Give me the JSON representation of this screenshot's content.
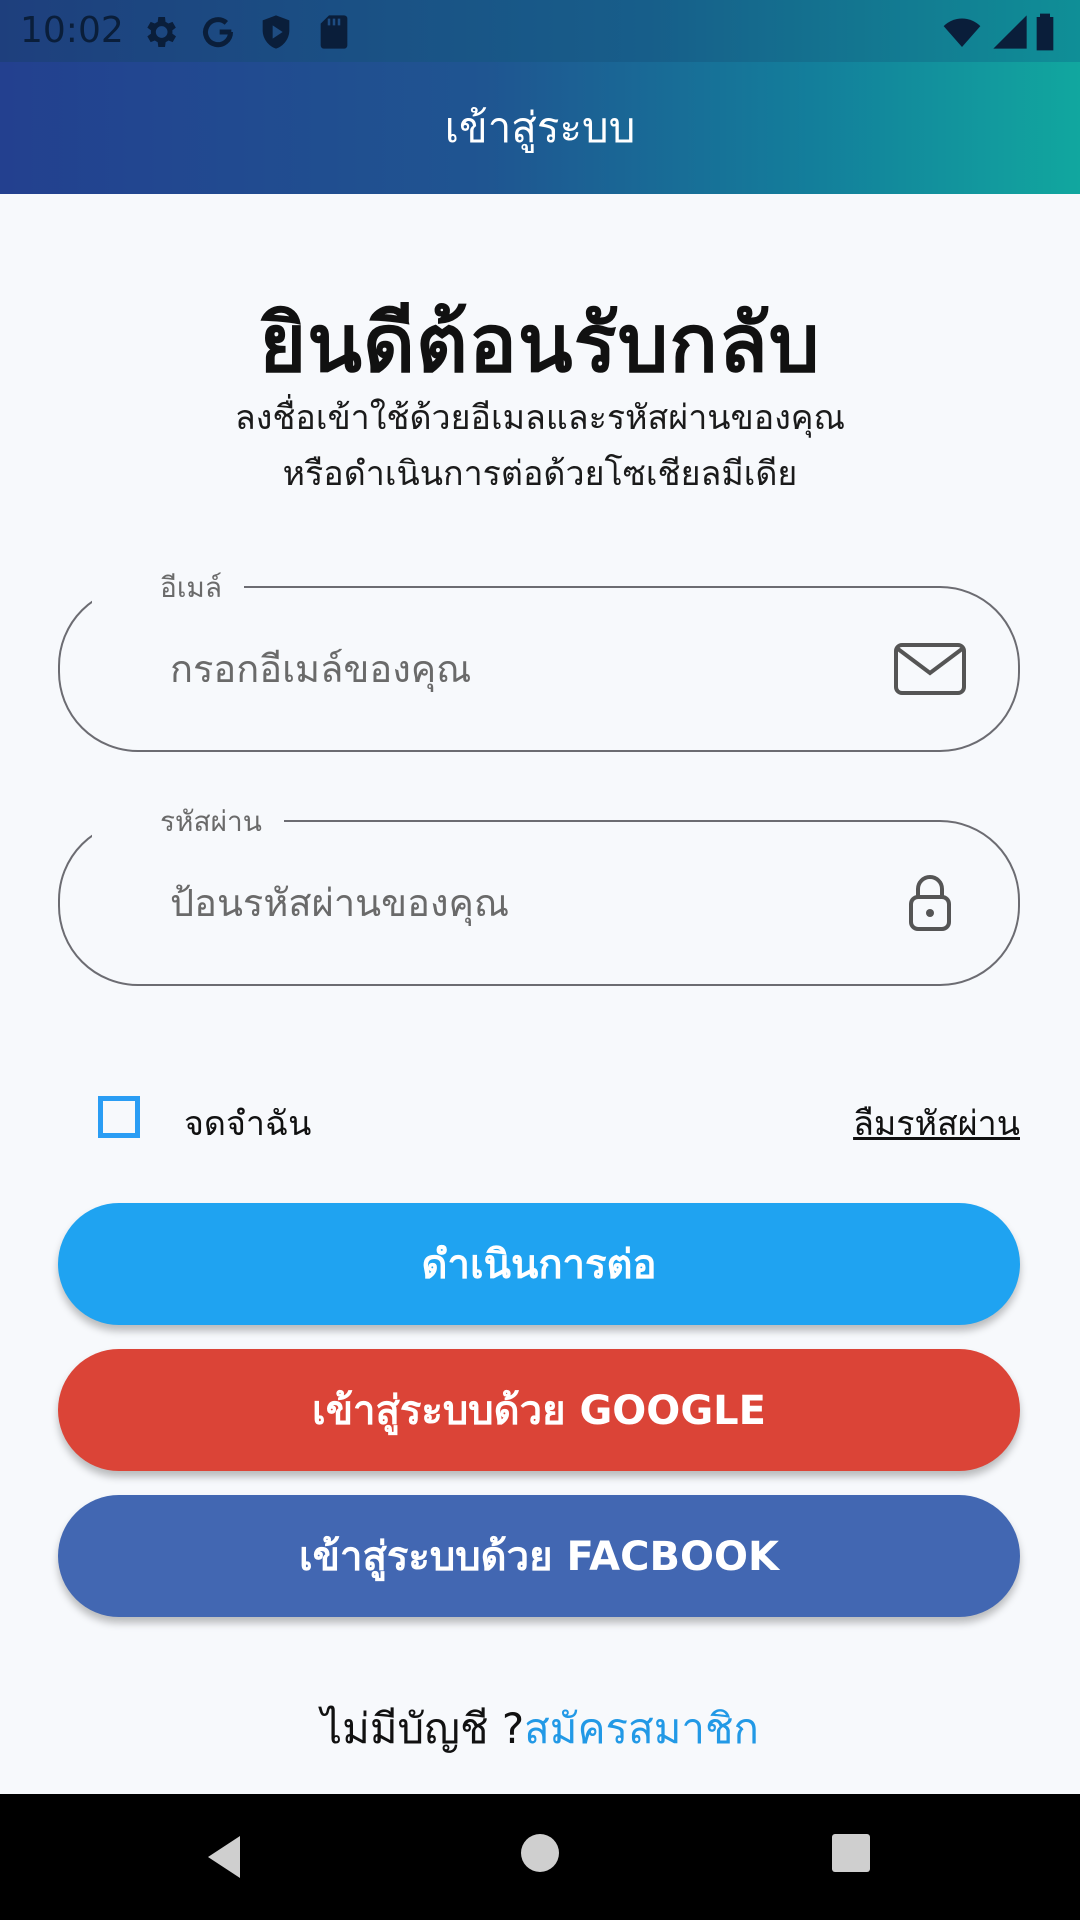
{
  "status_bar": {
    "time": "10:02",
    "icons": [
      "gear-icon",
      "google-icon",
      "shield-icon",
      "sd-card-icon",
      "wifi-icon",
      "signal-icon",
      "battery-icon"
    ]
  },
  "app_bar": {
    "title": "เข้าสู่ระบบ"
  },
  "welcome": {
    "title": "ยินดีต้อนรับกลับ",
    "subtitle_line1": "ลงชื่อเข้าใช้ด้วยอีเมลและรหัสผ่านของคุณ",
    "subtitle_line2": "หรือดำเนินการต่อด้วยโซเชียลมีเดีย"
  },
  "email_field": {
    "label": "อีเมล์",
    "placeholder": "กรอกอีเมล์ของคุณ",
    "value": "",
    "icon": "mail-icon"
  },
  "password_field": {
    "label": "รหัสผ่าน",
    "placeholder": "ป้อนรหัสผ่านของคุณ",
    "value": "",
    "icon": "lock-icon"
  },
  "remember": {
    "label": "จดจำฉัน",
    "checked": false
  },
  "forgot_password": {
    "label": "ลืมรหัสผ่าน"
  },
  "buttons": {
    "continue": {
      "label": "ดำเนินการต่อ",
      "color": "#1fa3f1"
    },
    "google": {
      "label": "เข้าสู่ระบบด้วย GOOGLE",
      "color": "#db4437"
    },
    "facebook": {
      "label": "เข้าสู่ระบบด้วย FACBOOK",
      "color": "#4267b2"
    }
  },
  "signup": {
    "question": "ไม่มีบัญชี ?",
    "link": "สมัครสมาชิก"
  },
  "nav_bar": {
    "buttons": [
      "back-icon",
      "home-icon",
      "recents-icon"
    ]
  }
}
